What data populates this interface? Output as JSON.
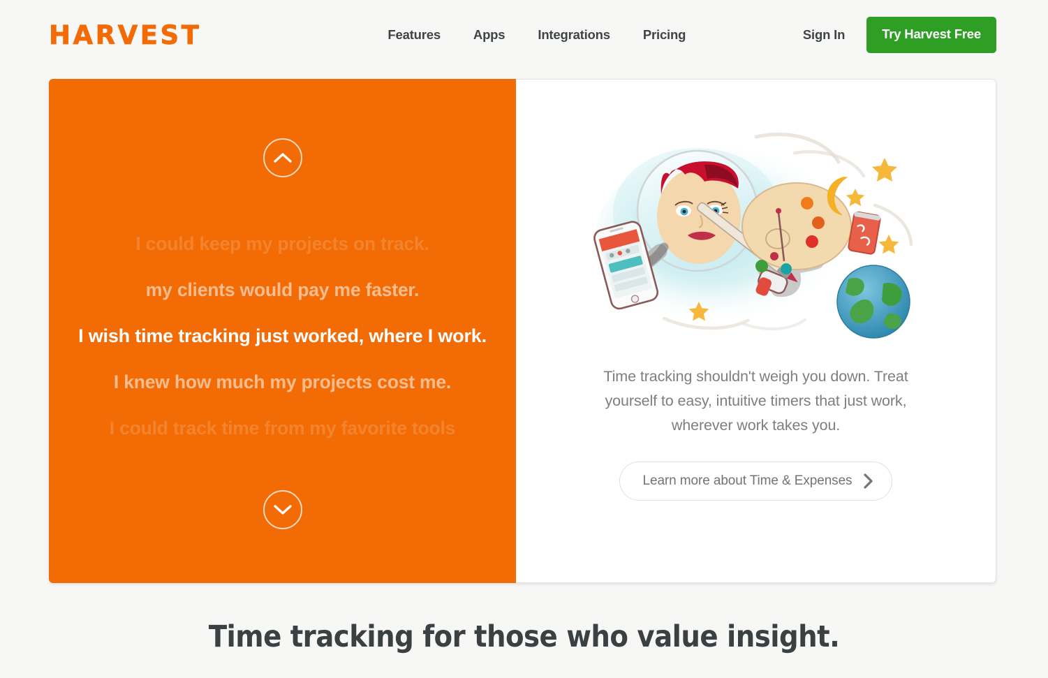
{
  "brand": {
    "logo": "HARVEST",
    "orange": "#f26b04",
    "green": "#2e9e24",
    "page_bg": "#f7f7f6",
    "text_dark": "#3f4447"
  },
  "header": {
    "nav": [
      {
        "label": "Features"
      },
      {
        "label": "Apps"
      },
      {
        "label": "Integrations"
      },
      {
        "label": "Pricing"
      }
    ],
    "sign_in": "Sign In",
    "cta": "Try Harvest Free"
  },
  "hero": {
    "carousel": {
      "up_icon": "chevron-up-icon",
      "down_icon": "chevron-down-icon",
      "lines": [
        {
          "text": "I could keep my projects on track.",
          "state": "faded-far"
        },
        {
          "text": "my clients would pay me faster.",
          "state": "faded-near"
        },
        {
          "text": "I wish time tracking just worked, where I work.",
          "state": "active"
        },
        {
          "text": "I knew how much my projects cost me.",
          "state": "faded-near"
        },
        {
          "text": "I could track time from my favorite tools",
          "state": "faded-far"
        }
      ]
    },
    "illustration": {
      "name": "astronaut-artist-illustration",
      "alt": "Watercolor astronaut with red hair holding a phone running Harvest, a paint palette, floating near a crescent moon, stars, a soda can and planet Earth"
    },
    "description": "Time tracking shouldn't weigh you down. Treat yourself to easy, intuitive timers that just work, wherever work takes you.",
    "learn_more": {
      "label": "Learn more about Time & Expenses",
      "icon": "chevron-right-icon"
    }
  },
  "bottom": {
    "headline": "Time tracking for those who value insight."
  }
}
